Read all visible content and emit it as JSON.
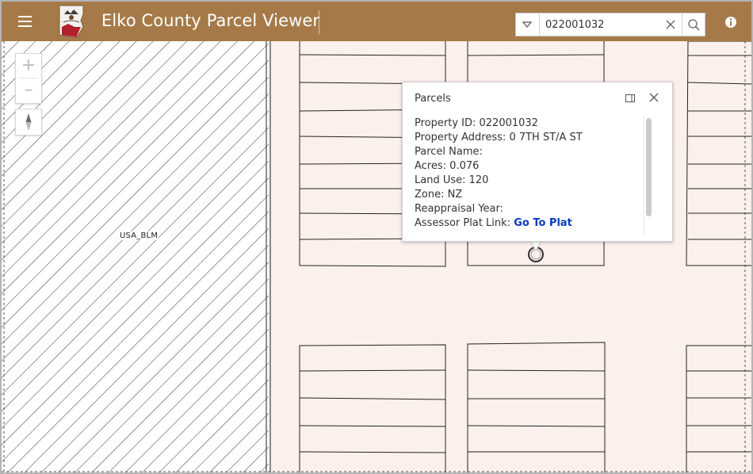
{
  "header": {
    "app_title": "Elko County Parcel Viewer",
    "logo_text": "Elko County",
    "background_color": "#a67a48"
  },
  "search": {
    "value": "022001032",
    "clear_icon": "close-icon",
    "submit_icon": "search-icon"
  },
  "icons": {
    "menu": "hamburger-menu-icon",
    "info": "info-icon",
    "compass": "compass-icon"
  },
  "map": {
    "blm_label": "USA_BLM",
    "zoom_in_label": "+",
    "zoom_out_label": "–",
    "parcel_fill": "#fcf0ec",
    "blm_hatch": "diagonal"
  },
  "popup": {
    "title": "Parcels",
    "attributes": [
      {
        "label": "Property ID:",
        "value": "022001032"
      },
      {
        "label": "Property Address:",
        "value": "0 7TH ST/A ST"
      },
      {
        "label": "Parcel Name:",
        "value": ""
      },
      {
        "label": "Acres:",
        "value": "0.076"
      },
      {
        "label": "Land Use:",
        "value": "120"
      },
      {
        "label": "Zone:",
        "value": "NZ"
      },
      {
        "label": "Reappraisal Year:",
        "value": ""
      }
    ],
    "plat_label": "Assessor Plat Link:",
    "plat_link_text": "Go To Plat",
    "link_color": "#0b3bbd"
  }
}
